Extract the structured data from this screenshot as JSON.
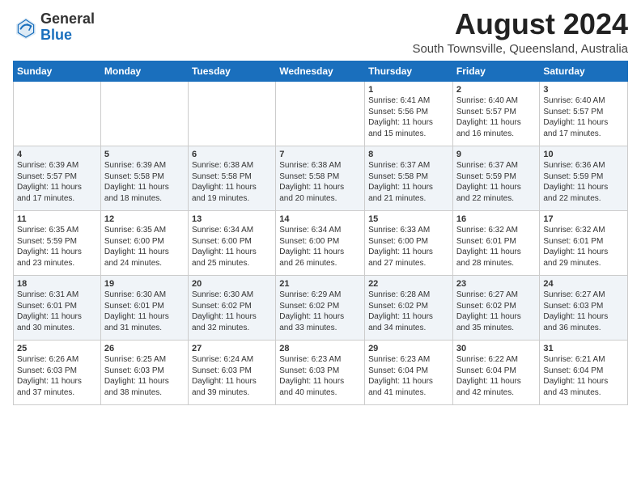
{
  "logo": {
    "general": "General",
    "blue": "Blue"
  },
  "title": "August 2024",
  "subtitle": "South Townsville, Queensland, Australia",
  "weekdays": [
    "Sunday",
    "Monday",
    "Tuesday",
    "Wednesday",
    "Thursday",
    "Friday",
    "Saturday"
  ],
  "weeks": [
    [
      {
        "day": "",
        "info": ""
      },
      {
        "day": "",
        "info": ""
      },
      {
        "day": "",
        "info": ""
      },
      {
        "day": "",
        "info": ""
      },
      {
        "day": "1",
        "info": "Sunrise: 6:41 AM\nSunset: 5:56 PM\nDaylight: 11 hours\nand 15 minutes."
      },
      {
        "day": "2",
        "info": "Sunrise: 6:40 AM\nSunset: 5:57 PM\nDaylight: 11 hours\nand 16 minutes."
      },
      {
        "day": "3",
        "info": "Sunrise: 6:40 AM\nSunset: 5:57 PM\nDaylight: 11 hours\nand 17 minutes."
      }
    ],
    [
      {
        "day": "4",
        "info": "Sunrise: 6:39 AM\nSunset: 5:57 PM\nDaylight: 11 hours\nand 17 minutes."
      },
      {
        "day": "5",
        "info": "Sunrise: 6:39 AM\nSunset: 5:58 PM\nDaylight: 11 hours\nand 18 minutes."
      },
      {
        "day": "6",
        "info": "Sunrise: 6:38 AM\nSunset: 5:58 PM\nDaylight: 11 hours\nand 19 minutes."
      },
      {
        "day": "7",
        "info": "Sunrise: 6:38 AM\nSunset: 5:58 PM\nDaylight: 11 hours\nand 20 minutes."
      },
      {
        "day": "8",
        "info": "Sunrise: 6:37 AM\nSunset: 5:58 PM\nDaylight: 11 hours\nand 21 minutes."
      },
      {
        "day": "9",
        "info": "Sunrise: 6:37 AM\nSunset: 5:59 PM\nDaylight: 11 hours\nand 22 minutes."
      },
      {
        "day": "10",
        "info": "Sunrise: 6:36 AM\nSunset: 5:59 PM\nDaylight: 11 hours\nand 22 minutes."
      }
    ],
    [
      {
        "day": "11",
        "info": "Sunrise: 6:35 AM\nSunset: 5:59 PM\nDaylight: 11 hours\nand 23 minutes."
      },
      {
        "day": "12",
        "info": "Sunrise: 6:35 AM\nSunset: 6:00 PM\nDaylight: 11 hours\nand 24 minutes."
      },
      {
        "day": "13",
        "info": "Sunrise: 6:34 AM\nSunset: 6:00 PM\nDaylight: 11 hours\nand 25 minutes."
      },
      {
        "day": "14",
        "info": "Sunrise: 6:34 AM\nSunset: 6:00 PM\nDaylight: 11 hours\nand 26 minutes."
      },
      {
        "day": "15",
        "info": "Sunrise: 6:33 AM\nSunset: 6:00 PM\nDaylight: 11 hours\nand 27 minutes."
      },
      {
        "day": "16",
        "info": "Sunrise: 6:32 AM\nSunset: 6:01 PM\nDaylight: 11 hours\nand 28 minutes."
      },
      {
        "day": "17",
        "info": "Sunrise: 6:32 AM\nSunset: 6:01 PM\nDaylight: 11 hours\nand 29 minutes."
      }
    ],
    [
      {
        "day": "18",
        "info": "Sunrise: 6:31 AM\nSunset: 6:01 PM\nDaylight: 11 hours\nand 30 minutes."
      },
      {
        "day": "19",
        "info": "Sunrise: 6:30 AM\nSunset: 6:01 PM\nDaylight: 11 hours\nand 31 minutes."
      },
      {
        "day": "20",
        "info": "Sunrise: 6:30 AM\nSunset: 6:02 PM\nDaylight: 11 hours\nand 32 minutes."
      },
      {
        "day": "21",
        "info": "Sunrise: 6:29 AM\nSunset: 6:02 PM\nDaylight: 11 hours\nand 33 minutes."
      },
      {
        "day": "22",
        "info": "Sunrise: 6:28 AM\nSunset: 6:02 PM\nDaylight: 11 hours\nand 34 minutes."
      },
      {
        "day": "23",
        "info": "Sunrise: 6:27 AM\nSunset: 6:02 PM\nDaylight: 11 hours\nand 35 minutes."
      },
      {
        "day": "24",
        "info": "Sunrise: 6:27 AM\nSunset: 6:03 PM\nDaylight: 11 hours\nand 36 minutes."
      }
    ],
    [
      {
        "day": "25",
        "info": "Sunrise: 6:26 AM\nSunset: 6:03 PM\nDaylight: 11 hours\nand 37 minutes."
      },
      {
        "day": "26",
        "info": "Sunrise: 6:25 AM\nSunset: 6:03 PM\nDaylight: 11 hours\nand 38 minutes."
      },
      {
        "day": "27",
        "info": "Sunrise: 6:24 AM\nSunset: 6:03 PM\nDaylight: 11 hours\nand 39 minutes."
      },
      {
        "day": "28",
        "info": "Sunrise: 6:23 AM\nSunset: 6:03 PM\nDaylight: 11 hours\nand 40 minutes."
      },
      {
        "day": "29",
        "info": "Sunrise: 6:23 AM\nSunset: 6:04 PM\nDaylight: 11 hours\nand 41 minutes."
      },
      {
        "day": "30",
        "info": "Sunrise: 6:22 AM\nSunset: 6:04 PM\nDaylight: 11 hours\nand 42 minutes."
      },
      {
        "day": "31",
        "info": "Sunrise: 6:21 AM\nSunset: 6:04 PM\nDaylight: 11 hours\nand 43 minutes."
      }
    ]
  ]
}
